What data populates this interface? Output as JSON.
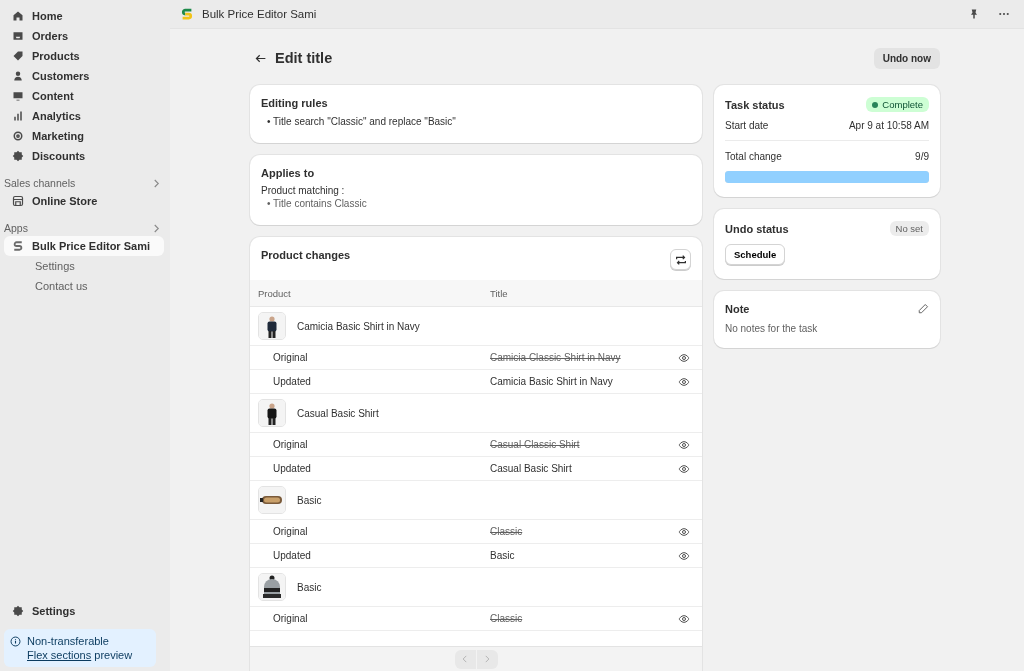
{
  "sidebar": {
    "nav": [
      {
        "label": "Home",
        "selected": false
      },
      {
        "label": "Orders",
        "selected": false
      },
      {
        "label": "Products",
        "selected": false
      },
      {
        "label": "Customers",
        "selected": false
      },
      {
        "label": "Content",
        "selected": false
      },
      {
        "label": "Analytics",
        "selected": false
      },
      {
        "label": "Marketing",
        "selected": false
      },
      {
        "label": "Discounts",
        "selected": false
      }
    ],
    "sales_channels": {
      "heading": "Sales channels",
      "items": [
        {
          "label": "Online Store",
          "selected": false
        }
      ]
    },
    "apps": {
      "heading": "Apps",
      "items": [
        {
          "label": "Bulk Price Editor Sami",
          "selected": true,
          "children": [
            {
              "label": "Settings"
            },
            {
              "label": "Contact us"
            }
          ]
        }
      ]
    },
    "settings": "Settings",
    "notice": {
      "title": "Non-transferable",
      "link": "Flex sections",
      "text": "preview"
    }
  },
  "top_bar": {
    "app_name": "Bulk Price Editor Sami"
  },
  "page": {
    "title": "Edit title",
    "undo_button": "Undo now"
  },
  "editing_rules": {
    "title": "Editing rules",
    "rules": [
      "• Title search \"Classic\" and replace \"Basic\""
    ]
  },
  "applies_to": {
    "title": "Applies to",
    "label": "Product matching :",
    "conditions": [
      "• Title contains Classic"
    ]
  },
  "product_changes": {
    "title": "Product changes",
    "columns": [
      "Product",
      "Title"
    ],
    "products": [
      {
        "name": "Camicia Basic Shirt in Navy",
        "rows": [
          {
            "label": "Original",
            "value": "Camicia Classic Shirt in Navy",
            "struck": true
          },
          {
            "label": "Updated",
            "value": "Camicia Basic Shirt in Navy",
            "struck": false
          }
        ]
      },
      {
        "name": "Casual Basic Shirt",
        "rows": [
          {
            "label": "Original",
            "value": "Casual Classic Shirt",
            "struck": true
          },
          {
            "label": "Updated",
            "value": "Casual Basic Shirt",
            "struck": false
          }
        ]
      },
      {
        "name": "Basic",
        "rows": [
          {
            "label": "Original",
            "value": "Classic",
            "struck": true
          },
          {
            "label": "Updated",
            "value": "Basic",
            "struck": false
          }
        ]
      },
      {
        "name": "Basic",
        "rows": [
          {
            "label": "Original",
            "value": "Classic",
            "struck": true
          }
        ]
      }
    ]
  },
  "task_status": {
    "title": "Task status",
    "badge": "Complete",
    "start_label": "Start date",
    "start_value": "Apr 9 at 10:58 AM",
    "total_label": "Total change",
    "total_value": "9/9",
    "level": 1
  },
  "undo_status": {
    "title": "Undo status",
    "badge": "No set",
    "button": "Schedule"
  },
  "note": {
    "title": "Note",
    "text": "No notes for the task"
  }
}
